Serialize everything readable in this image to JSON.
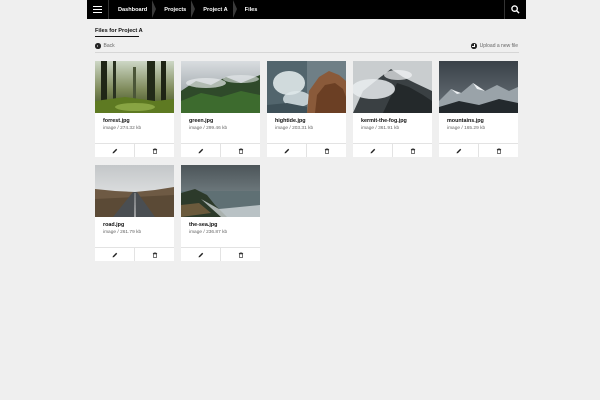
{
  "nav": {
    "menu_icon": "hamburger-icon",
    "search_icon": "search-icon",
    "breadcrumbs": [
      "Dashboard",
      "Projects",
      "Project A",
      "Files"
    ]
  },
  "page": {
    "title": "Files for Project A",
    "back_label": "Back",
    "upload_label": "Upload a new file"
  },
  "files": [
    {
      "name": "forrest.jpg",
      "meta": "image / 274.32 kb",
      "thumb": "forest"
    },
    {
      "name": "green.jpg",
      "meta": "image / 299.46 kb",
      "thumb": "green-hills"
    },
    {
      "name": "hightide.jpg",
      "meta": "image / 203.31 kb",
      "thumb": "wave-rocks"
    },
    {
      "name": "kermit-the-fog.jpg",
      "meta": "image / 361.91 kb",
      "thumb": "foggy-mountain"
    },
    {
      "name": "mountains.jpg",
      "meta": "image / 165.29 kb",
      "thumb": "mountains"
    },
    {
      "name": "road.jpg",
      "meta": "image / 261.79 kb",
      "thumb": "road"
    },
    {
      "name": "the-sea.jpg",
      "meta": "image / 236.87 kb",
      "thumb": "coast"
    }
  ],
  "card_actions": {
    "edit_icon": "pencil-icon",
    "delete_icon": "trash-icon"
  },
  "colors": {
    "topbar": "#000000",
    "background": "#efefef",
    "card": "#ffffff"
  }
}
